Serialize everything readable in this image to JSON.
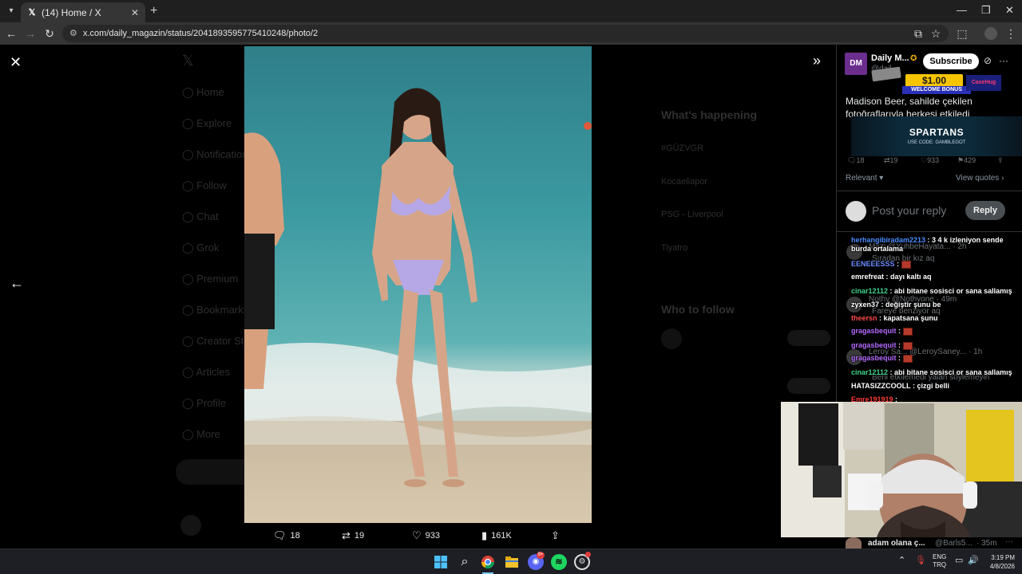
{
  "browser": {
    "tab_title": "(14) Home / X",
    "url": "x.com/daily_magazin/status/2041893595775410248/photo/2"
  },
  "x_nav_bg": [
    "Home",
    "Explore",
    "Notifications",
    "Follow",
    "Chat",
    "Grok",
    "Premium",
    "Bookmarks",
    "Creator Studio",
    "Articles",
    "Profile",
    "More"
  ],
  "x_right_bg": {
    "whats_happening": "What's happening",
    "trends": [
      "#GÜZVGR",
      "Kocaeliapor",
      "PSG - Liverpool",
      "Tiyatro"
    ],
    "who_to_follow": "Who to follow",
    "follow_label": "Follow"
  },
  "viewer_actions": {
    "replies": "18",
    "reposts": "19",
    "likes": "933",
    "views": "161K"
  },
  "post": {
    "avatar_text": "DM",
    "author": "Daily M...",
    "handle": "@dail...",
    "subscribe": "Subscribe",
    "text": "Madison Beer, sahilde çekilen fotoğraflarıyla herkesi etkiledi",
    "stats": {
      "replies": "18",
      "reposts": "19",
      "likes": "933",
      "bookmarks": "429"
    },
    "sort_label": "Relevant",
    "view_quotes": "View quotes",
    "reply_placeholder": "Post your reply",
    "reply_button": "Reply"
  },
  "faded_replies": [
    {
      "name": "Mazi",
      "handle": "@YuhbeHayata...",
      "time": "2h",
      "text": "Sıradan bir kız aq"
    },
    {
      "name": "Nothy",
      "handle": "@Nothyone",
      "time": "49m",
      "text": "Fareye benziyor aq"
    },
    {
      "name": "Leroy Sa...",
      "handle": "@LeroySaney...",
      "time": "1h",
      "text": "Beni etkilemedi yalan söylemeyin"
    }
  ],
  "chat": [
    {
      "user": "herhangibiradam2213",
      "color": "#4a8cff",
      "msg": " : 3 4 k izleniyon sende burda ortalama"
    },
    {
      "user": "EENEEESSS",
      "color": "#6a8bff",
      "msg": " : ",
      "emote": true
    },
    {
      "user": "emrefreat",
      "color": "#ffffff",
      "msg": " : dayı kaltı aq"
    },
    {
      "user": "cinar12112",
      "color": "#3fd48a",
      "msg": " : abi bitane sosisci or sana sallamış"
    },
    {
      "user": "zyxen37",
      "color": "#ffffff",
      "msg": " : değiştir şunu be"
    },
    {
      "user": "theersn",
      "color": "#ff4a4a",
      "msg": " : kapatsana şunu"
    },
    {
      "user": "gragasbequit",
      "color": "#b46cff",
      "msg": " : ",
      "emote": true
    },
    {
      "user": "gragasbequit",
      "color": "#b46cff",
      "msg": " : ",
      "emote": true
    },
    {
      "user": "gragasbequit",
      "color": "#b46cff",
      "msg": " : ",
      "emote": true
    },
    {
      "user": "cinar12112",
      "color": "#3fd48a",
      "msg": " : abi bitane sosisci or sana sallamış"
    },
    {
      "user": "HATASIZZCOOLL",
      "color": "#ffffff",
      "msg": " : çizgi belli"
    },
    {
      "user": "Emre191919",
      "color": "#ff3a3a",
      "msg": " : "
    }
  ],
  "ads": {
    "money": "$1.00",
    "bonus": "WELCOME BONUS",
    "case": "CaseHug",
    "spartans": "SPARTANS",
    "code": "USE CODE: GAMBLEGOT"
  },
  "bottom_reply": {
    "name": "adam olana ç...",
    "handle": "@Barls5...",
    "time": "35m"
  },
  "taskbar": {
    "lang1": "ENG",
    "lang2": "TRQ",
    "time": "3:19 PM",
    "date": "4/8/2026",
    "discord_badge": "9+"
  },
  "colors": {
    "accent": "#1d9bf0",
    "verified": "#f7b500"
  }
}
